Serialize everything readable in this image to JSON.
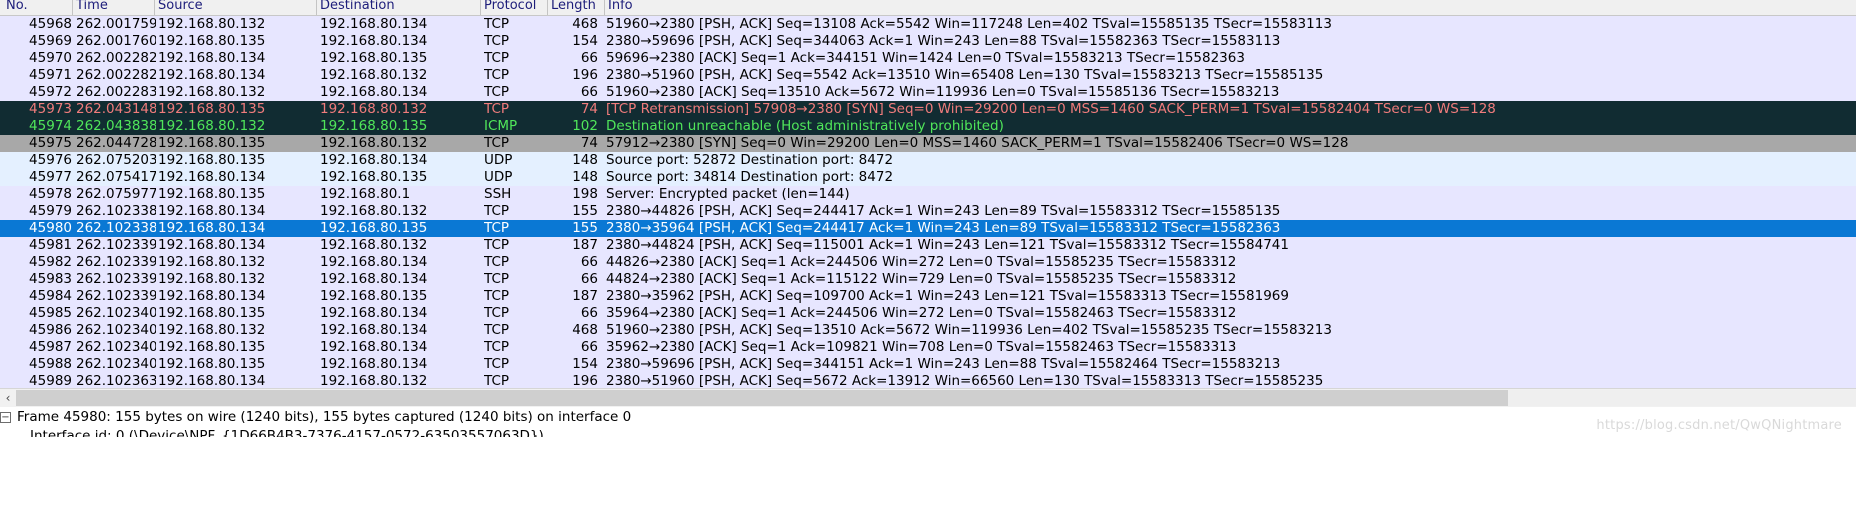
{
  "packet_list": {
    "columns": [
      {
        "key": "no",
        "label": "No."
      },
      {
        "key": "time",
        "label": "Time"
      },
      {
        "key": "source",
        "label": "Source"
      },
      {
        "key": "destination",
        "label": "Destination"
      },
      {
        "key": "protocol",
        "label": "Protocol"
      },
      {
        "key": "length",
        "label": "Length"
      },
      {
        "key": "info",
        "label": "Info"
      }
    ],
    "rows": [
      {
        "no": "45968",
        "time": "262.001759",
        "source": "192.168.80.132",
        "destination": "192.168.80.134",
        "protocol": "TCP",
        "length": "468",
        "info": "51960→2380 [PSH, ACK] Seq=13108 Ack=5542 Win=117248 Len=402 TSval=15585135 TSecr=15583113",
        "style": "lavender"
      },
      {
        "no": "45969",
        "time": "262.001760",
        "source": "192.168.80.135",
        "destination": "192.168.80.134",
        "protocol": "TCP",
        "length": "154",
        "info": "2380→59696 [PSH, ACK] Seq=344063 Ack=1 Win=243 Len=88 TSval=15582363 TSecr=15583113",
        "style": "lavender"
      },
      {
        "no": "45970",
        "time": "262.002282",
        "source": "192.168.80.134",
        "destination": "192.168.80.135",
        "protocol": "TCP",
        "length": "66",
        "info": "59696→2380 [ACK] Seq=1 Ack=344151 Win=1424 Len=0 TSval=15583213 TSecr=15582363",
        "style": "lavender"
      },
      {
        "no": "45971",
        "time": "262.002282",
        "source": "192.168.80.134",
        "destination": "192.168.80.132",
        "protocol": "TCP",
        "length": "196",
        "info": "2380→51960 [PSH, ACK] Seq=5542 Ack=13510 Win=65408 Len=130 TSval=15583213 TSecr=15585135",
        "style": "lavender"
      },
      {
        "no": "45972",
        "time": "262.002283",
        "source": "192.168.80.132",
        "destination": "192.168.80.134",
        "protocol": "TCP",
        "length": "66",
        "info": "51960→2380 [ACK] Seq=13510 Ack=5672 Win=119936 Len=0 TSval=15585136 TSecr=15583213",
        "style": "lavender"
      },
      {
        "no": "45973",
        "time": "262.043148",
        "source": "192.168.80.135",
        "destination": "192.168.80.132",
        "protocol": "TCP",
        "length": "74",
        "info": "[TCP Retransmission] 57908→2380 [SYN] Seq=0 Win=29200 Len=0 MSS=1460 SACK_PERM=1 TSval=15582404 TSecr=0 WS=128",
        "style": "bad"
      },
      {
        "no": "45974",
        "time": "262.043838",
        "source": "192.168.80.132",
        "destination": "192.168.80.135",
        "protocol": "ICMP",
        "length": "102",
        "info": "Destination unreachable (Host administratively prohibited)",
        "style": "icmp"
      },
      {
        "no": "45975",
        "time": "262.044728",
        "source": "192.168.80.135",
        "destination": "192.168.80.132",
        "protocol": "TCP",
        "length": "74",
        "info": "57912→2380 [SYN] Seq=0 Win=29200 Len=0 MSS=1460 SACK_PERM=1 TSval=15582406 TSecr=0 WS=128",
        "style": "gray"
      },
      {
        "no": "45976",
        "time": "262.075203",
        "source": "192.168.80.135",
        "destination": "192.168.80.134",
        "protocol": "UDP",
        "length": "148",
        "info": "Source port: 52872  Destination port: 8472",
        "style": "lightblue"
      },
      {
        "no": "45977",
        "time": "262.075417",
        "source": "192.168.80.134",
        "destination": "192.168.80.135",
        "protocol": "UDP",
        "length": "148",
        "info": "Source port: 34814  Destination port: 8472",
        "style": "lightblue"
      },
      {
        "no": "45978",
        "time": "262.075977",
        "source": "192.168.80.135",
        "destination": "192.168.80.1",
        "protocol": "SSH",
        "length": "198",
        "info": "Server: Encrypted packet (len=144)",
        "style": "lavender"
      },
      {
        "no": "45979",
        "time": "262.102338",
        "source": "192.168.80.134",
        "destination": "192.168.80.132",
        "protocol": "TCP",
        "length": "155",
        "info": "2380→44826 [PSH, ACK] Seq=244417 Ack=1 Win=243 Len=89 TSval=15583312 TSecr=15585135",
        "style": "lavender"
      },
      {
        "no": "45980",
        "time": "262.102338",
        "source": "192.168.80.134",
        "destination": "192.168.80.135",
        "protocol": "TCP",
        "length": "155",
        "info": "2380→35964 [PSH, ACK] Seq=244417 Ack=1 Win=243 Len=89 TSval=15583312 TSecr=15582363",
        "style": "selected"
      },
      {
        "no": "45981",
        "time": "262.102339",
        "source": "192.168.80.134",
        "destination": "192.168.80.132",
        "protocol": "TCP",
        "length": "187",
        "info": "2380→44824 [PSH, ACK] Seq=115001 Ack=1 Win=243 Len=121 TSval=15583312 TSecr=15584741",
        "style": "lavender"
      },
      {
        "no": "45982",
        "time": "262.102339",
        "source": "192.168.80.132",
        "destination": "192.168.80.134",
        "protocol": "TCP",
        "length": "66",
        "info": "44826→2380 [ACK] Seq=1 Ack=244506 Win=272 Len=0 TSval=15585235 TSecr=15583312",
        "style": "lavender"
      },
      {
        "no": "45983",
        "time": "262.102339",
        "source": "192.168.80.132",
        "destination": "192.168.80.134",
        "protocol": "TCP",
        "length": "66",
        "info": "44824→2380 [ACK] Seq=1 Ack=115122 Win=729 Len=0 TSval=15585235 TSecr=15583312",
        "style": "lavender"
      },
      {
        "no": "45984",
        "time": "262.102339",
        "source": "192.168.80.134",
        "destination": "192.168.80.135",
        "protocol": "TCP",
        "length": "187",
        "info": "2380→35962 [PSH, ACK] Seq=109700 Ack=1 Win=243 Len=121 TSval=15583313 TSecr=15581969",
        "style": "lavender"
      },
      {
        "no": "45985",
        "time": "262.102340",
        "source": "192.168.80.135",
        "destination": "192.168.80.134",
        "protocol": "TCP",
        "length": "66",
        "info": "35964→2380 [ACK] Seq=1 Ack=244506 Win=272 Len=0 TSval=15582463 TSecr=15583312",
        "style": "lavender"
      },
      {
        "no": "45986",
        "time": "262.102340",
        "source": "192.168.80.132",
        "destination": "192.168.80.134",
        "protocol": "TCP",
        "length": "468",
        "info": "51960→2380 [PSH, ACK] Seq=13510 Ack=5672 Win=119936 Len=402 TSval=15585235 TSecr=15583213",
        "style": "lavender"
      },
      {
        "no": "45987",
        "time": "262.102340",
        "source": "192.168.80.135",
        "destination": "192.168.80.134",
        "protocol": "TCP",
        "length": "66",
        "info": "35962→2380 [ACK] Seq=1 Ack=109821 Win=708 Len=0 TSval=15582463 TSecr=15583313",
        "style": "lavender"
      },
      {
        "no": "45988",
        "time": "262.102340",
        "source": "192.168.80.135",
        "destination": "192.168.80.134",
        "protocol": "TCP",
        "length": "154",
        "info": "2380→59696 [PSH, ACK] Seq=344151 Ack=1 Win=243 Len=88 TSval=15582464 TSecr=15583213",
        "style": "lavender"
      },
      {
        "no": "45989",
        "time": "262.102363",
        "source": "192.168.80.134",
        "destination": "192.168.80.132",
        "protocol": "TCP",
        "length": "196",
        "info": "2380→51960 [PSH, ACK] Seq=5672 Ack=13912 Win=66560 Len=130 TSval=15583313 TSecr=15585235",
        "style": "lavender"
      }
    ]
  },
  "scrollbar": {
    "left_arrow": "‹"
  },
  "detail_pane": {
    "lines": [
      {
        "twisty": "−",
        "text": "Frame 45980: 155 bytes on wire (1240 bits), 155 bytes captured (1240 bits) on interface 0"
      },
      {
        "twisty": "",
        "text": "Interface id: 0 (\\Device\\NPF_{1D66B4B3-7376-4157-0572-63503557063D})"
      }
    ]
  },
  "watermark": {
    "text": "https://blog.csdn.net/QwQNightmare"
  },
  "colors": {
    "selected_row_bg": "#0a78d4",
    "bad_row_bg": "#112c32",
    "bad_row_fg": "#f07c7c",
    "icmp_row_fg": "#50e65a",
    "gray_row_bg": "#a8a8a8",
    "lavender_row_bg": "#e7e6ff",
    "lightblue_row_bg": "#e4f0ff"
  }
}
